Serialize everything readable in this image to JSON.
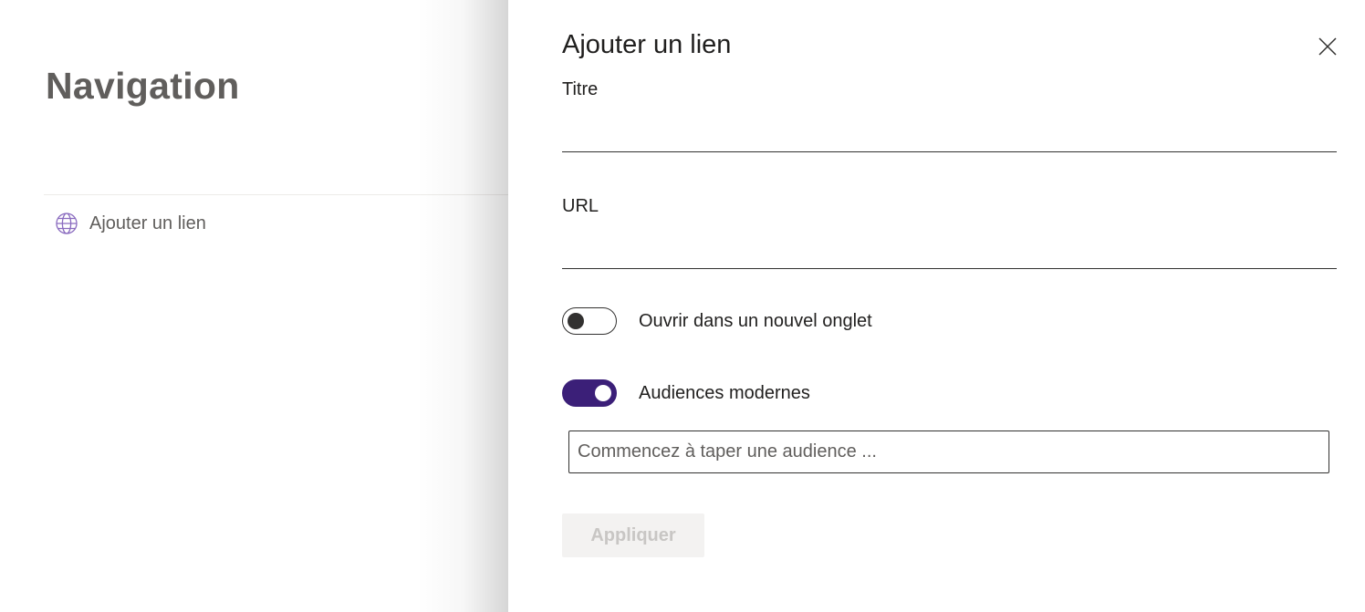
{
  "navigation": {
    "title": "Navigation",
    "add_link_label": "Ajouter un lien",
    "add_link_icon": "globe-icon"
  },
  "panel": {
    "title": "Ajouter un lien",
    "close_icon": "close-icon",
    "title_field": {
      "label": "Titre",
      "value": ""
    },
    "url_field": {
      "label": "URL",
      "value": ""
    },
    "open_new_tab": {
      "label": "Ouvrir dans un nouvel onglet",
      "checked": false
    },
    "modern_audiences": {
      "label": "Audiences modernes",
      "checked": true
    },
    "audience_input": {
      "placeholder": "Commencez à taper une audience ...",
      "value": ""
    },
    "apply_label": "Appliquer"
  },
  "colors": {
    "accent": "#3b1f78",
    "globe_icon": "#8a6bbf",
    "nav_text": "#605e5c",
    "disabled_bg": "#f3f2f1",
    "disabled_text": "#c8c6c4"
  }
}
